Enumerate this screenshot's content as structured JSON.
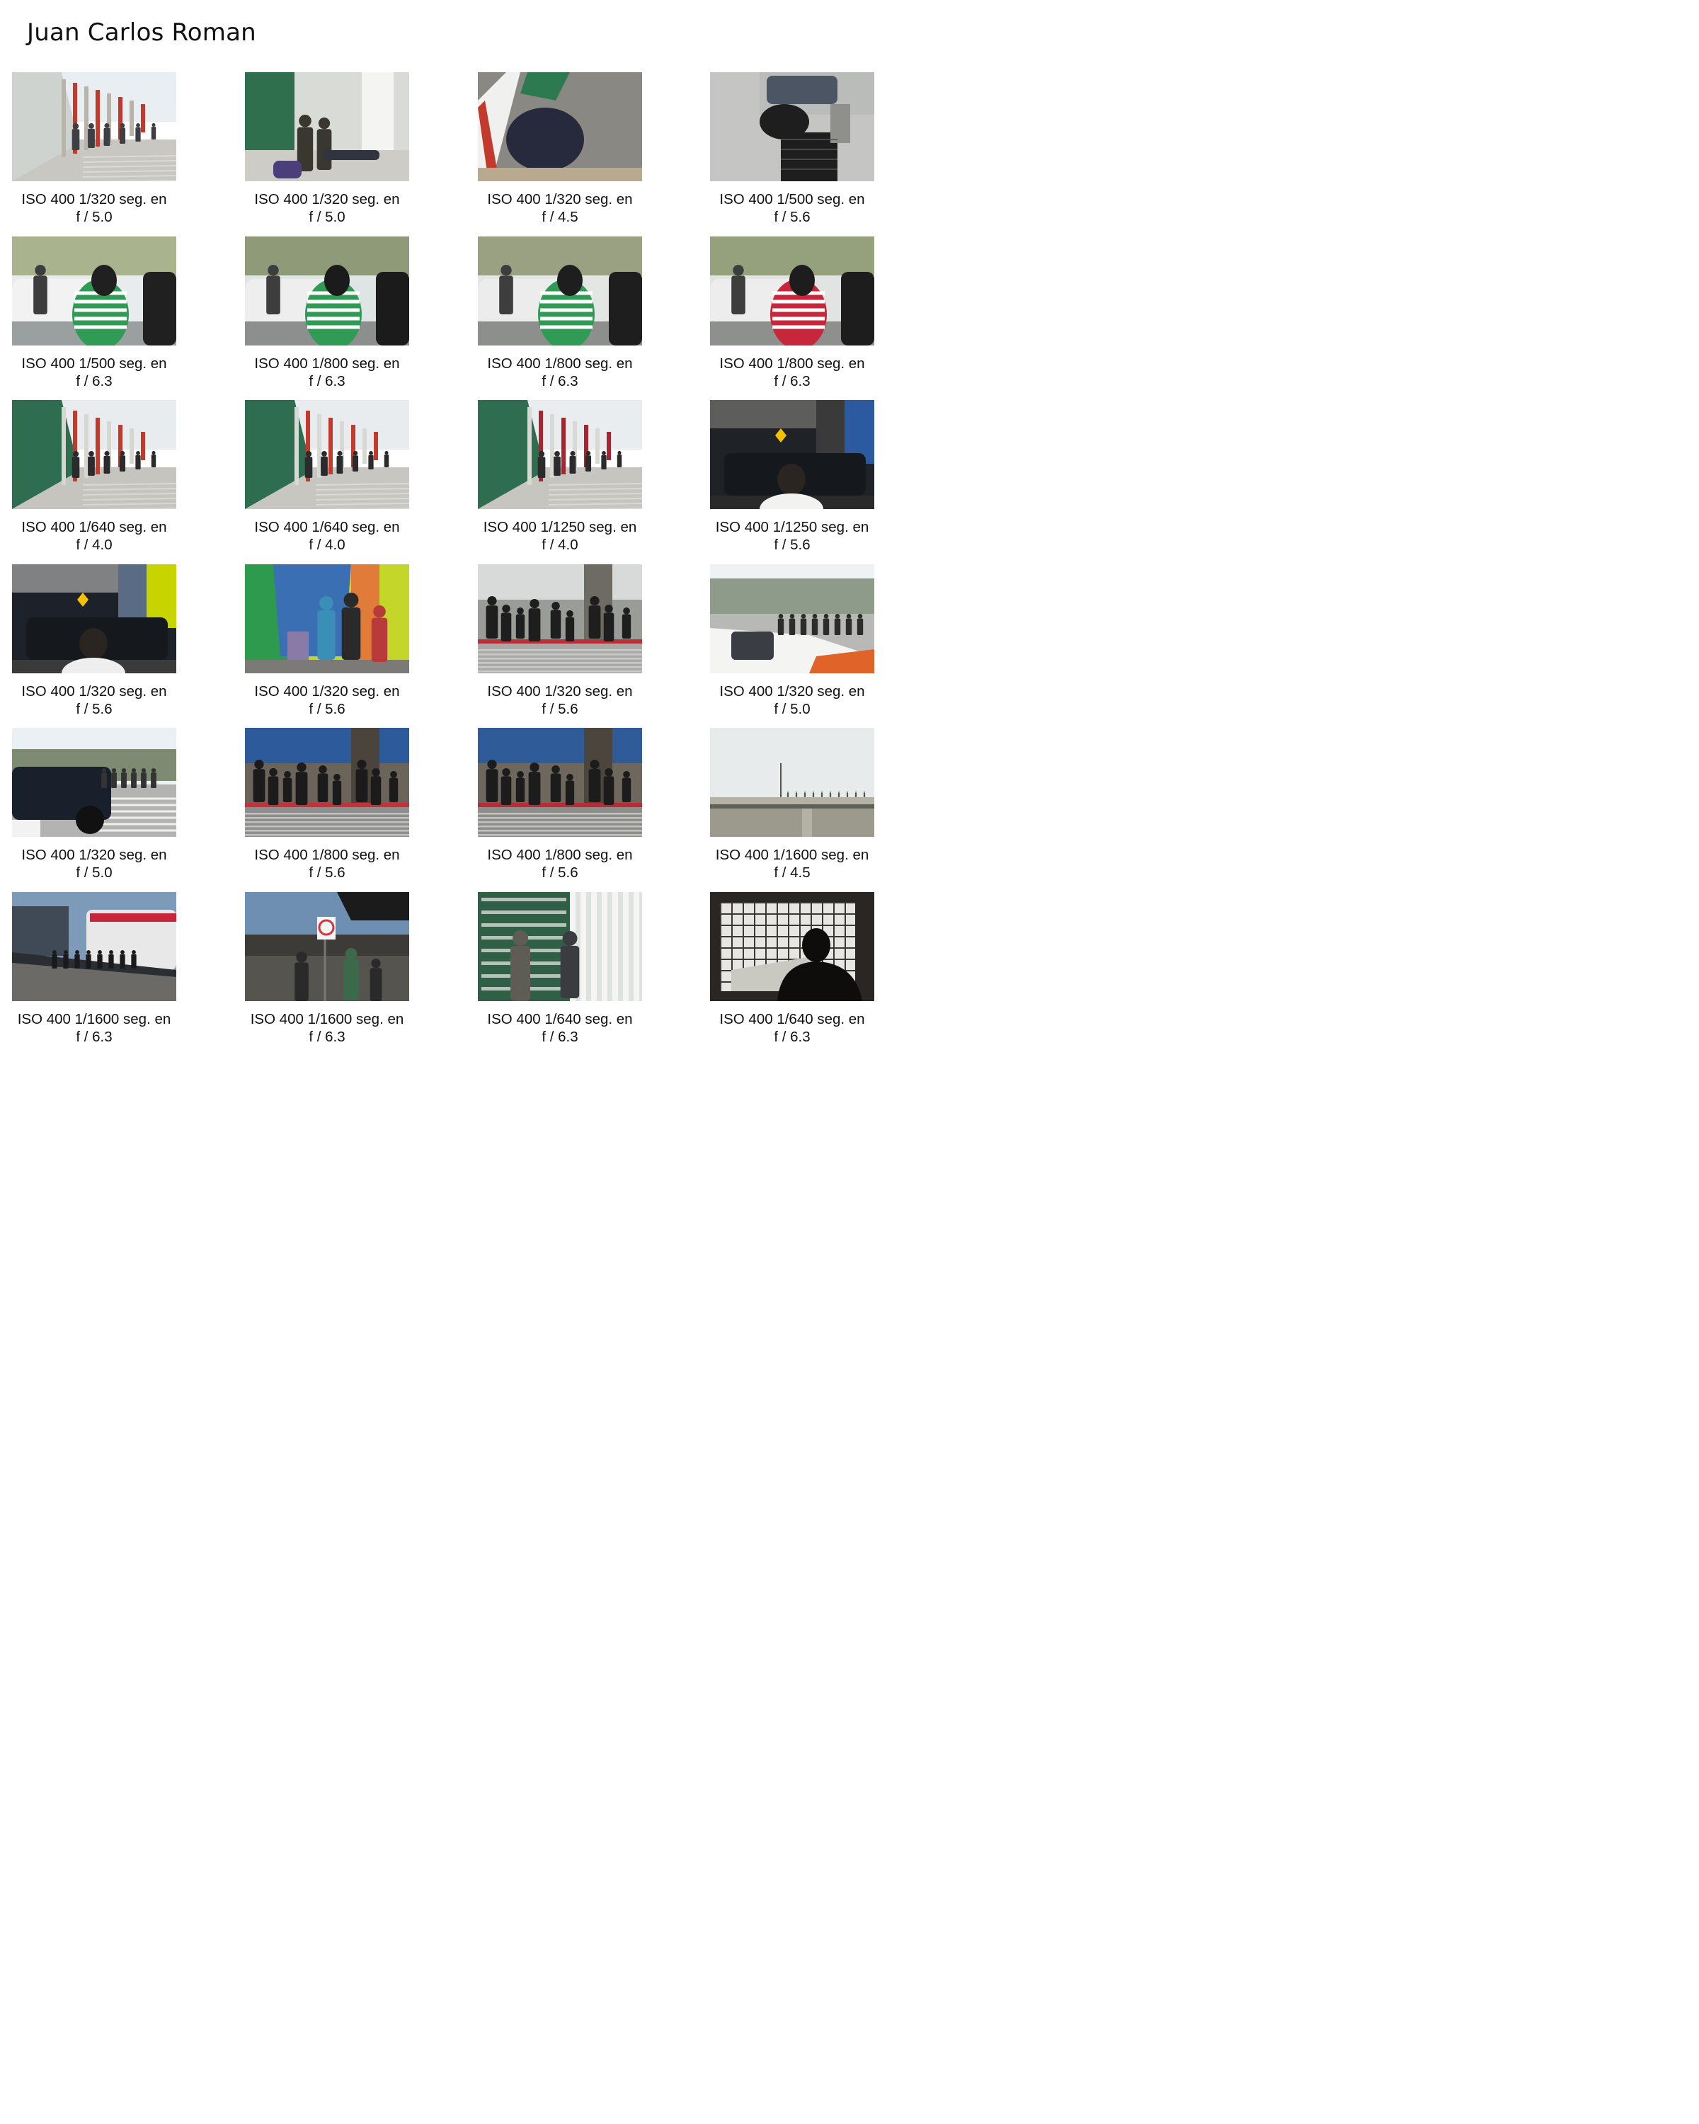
{
  "title": "Juan Carlos Roman",
  "photos": [
    {
      "exposure": "ISO 400 1/320 seg. en",
      "aperture": "f / 5.0",
      "scene": "letters-street",
      "colors": {
        "sky": "#e9eef2",
        "top": "#cfd3cf",
        "mid": "#b8b4aa",
        "ground": "#c9c7c2",
        "accent": "#c23a2c",
        "subject": "#3d3f44"
      }
    },
    {
      "exposure": "ISO 400 1/320 seg. en",
      "aperture": "f / 5.0",
      "scene": "letters-close",
      "colors": {
        "sky": "#eef1f0",
        "top": "#2f6f4e",
        "mid": "#d9dcd6",
        "ground": "#cdccc6",
        "accent": "#2b7a52",
        "subject": "#3a3630"
      }
    },
    {
      "exposure": "ISO 400 1/320 seg. en",
      "aperture": "f / 4.5",
      "scene": "ground-sitting",
      "colors": {
        "sky": "#8e8d88",
        "top": "#2e7a50",
        "mid": "#6f6c66",
        "ground": "#8a8883",
        "accent": "#c23a2c",
        "subject": "#262a3c"
      }
    },
    {
      "exposure": "ISO 400 1/500 seg. en",
      "aperture": "f / 5.6",
      "scene": "cart-street",
      "colors": {
        "sky": "#d9dbd8",
        "top": "#b9bcb9",
        "mid": "#8f8f8c",
        "ground": "#c5c6c4",
        "accent": "#4b5563",
        "subject": "#1e1e1f"
      }
    },
    {
      "exposure": "ISO 400 1/500 seg. en",
      "aperture": "f / 6.3",
      "scene": "crowd-taxi",
      "colors": {
        "sky": "#e8ecee",
        "top": "#a9b48f",
        "mid": "#f2f2f2",
        "ground": "#9aa0a0",
        "accent": "#2f9b55",
        "subject": "#202020"
      }
    },
    {
      "exposure": "ISO 400 1/800 seg. en",
      "aperture": "f / 6.3",
      "scene": "crowd-taxi",
      "colors": {
        "sky": "#dfe4e4",
        "top": "#8f9a79",
        "mid": "#eeeeee",
        "ground": "#8c8f8d",
        "accent": "#2f9b55",
        "subject": "#1b1b1b"
      }
    },
    {
      "exposure": "ISO 400 1/800 seg. en",
      "aperture": "f / 6.3",
      "scene": "crowd-taxi",
      "colors": {
        "sky": "#e4e6e4",
        "top": "#9aa183",
        "mid": "#ececec",
        "ground": "#8d8f8c",
        "accent": "#2f9b55",
        "subject": "#1e1e1e"
      }
    },
    {
      "exposure": "ISO 400 1/800 seg. en",
      "aperture": "f / 6.3",
      "scene": "crowd-taxi",
      "colors": {
        "sky": "#e1e4e2",
        "top": "#95a07d",
        "mid": "#ededed",
        "ground": "#8e908d",
        "accent": "#c8263a",
        "subject": "#1d1d1d"
      }
    },
    {
      "exposure": "ISO 400 1/640 seg. en",
      "aperture": "f / 4.0",
      "scene": "letters-street",
      "colors": {
        "sky": "#e8ecef",
        "top": "#2e6d4f",
        "mid": "#d7d7d2",
        "ground": "#c5c4be",
        "accent": "#c23a2c",
        "subject": "#2b2b2d"
      }
    },
    {
      "exposure": "ISO 400 1/640 seg. en",
      "aperture": "f / 4.0",
      "scene": "letters-street",
      "colors": {
        "sky": "#e9ecee",
        "top": "#2e6d4f",
        "mid": "#d9d9d4",
        "ground": "#c7c6c0",
        "accent": "#c23a2c",
        "subject": "#2b2b2d"
      }
    },
    {
      "exposure": "ISO 400 1/1250 seg. en",
      "aperture": "f / 4.0",
      "scene": "letters-street",
      "colors": {
        "sky": "#eaedef",
        "top": "#2e6d4f",
        "mid": "#d9d9d4",
        "ground": "#c6c5bf",
        "accent": "#a8242f",
        "subject": "#2b2b2d"
      }
    },
    {
      "exposure": "ISO 400 1/1250 seg. en",
      "aperture": "f / 5.6",
      "scene": "police-dark",
      "colors": {
        "sky": "#5d5d5c",
        "top": "#3a3a3b",
        "mid": "#1f2226",
        "ground": "#2a2a2a",
        "accent": "#2c5aa0",
        "subject": "#f2f2f0"
      }
    },
    {
      "exposure": "ISO 400 1/320 seg. en",
      "aperture": "f / 5.6",
      "scene": "police-dark",
      "colors": {
        "sky": "#7f8183",
        "top": "#5a6b84",
        "mid": "#1d222a",
        "ground": "#3a3a3a",
        "accent": "#c8d400",
        "subject": "#efefef"
      }
    },
    {
      "exposure": "ISO 400 1/320 seg. en",
      "aperture": "f / 5.6",
      "scene": "colorful-wall",
      "colors": {
        "sky": "#c4d62a",
        "top": "#3a6fb4",
        "mid": "#e07b3a",
        "ground": "#7c7a76",
        "accent": "#2d9a4e",
        "subject": "#2a2a2a"
      }
    },
    {
      "exposure": "ISO 400 1/320 seg. en",
      "aperture": "f / 5.6",
      "scene": "crossing",
      "colors": {
        "sky": "#d8dada",
        "top": "#9a9c97",
        "mid": "#6e6a64",
        "ground": "#a9aaa7",
        "accent": "#b8303a",
        "subject": "#1e1e1e"
      }
    },
    {
      "exposure": "ISO 400 1/320 seg. en",
      "aperture": "f / 5.0",
      "scene": "taxi-street",
      "colors": {
        "sky": "#eef2f4",
        "top": "#8e9a8a",
        "mid": "#d9dcd8",
        "ground": "#b8b9b6",
        "accent": "#e0632a",
        "subject": "#2c2c2c"
      }
    },
    {
      "exposure": "ISO 400 1/320 seg. en",
      "aperture": "f / 5.0",
      "scene": "jeep-street",
      "colors": {
        "sky": "#eaf0f4",
        "top": "#7d8b73",
        "mid": "#c9ccc8",
        "ground": "#b3b4b1",
        "accent": "#1f2a44",
        "subject": "#1a1f2c"
      }
    },
    {
      "exposure": "ISO 400 1/800 seg. en",
      "aperture": "f / 5.6",
      "scene": "crossing",
      "colors": {
        "sky": "#2d5a9a",
        "top": "#6a645b",
        "mid": "#4a443c",
        "ground": "#8e8f8c",
        "accent": "#c8303a",
        "subject": "#1b1b1b"
      }
    },
    {
      "exposure": "ISO 400 1/800 seg. en",
      "aperture": "f / 5.6",
      "scene": "crossing",
      "colors": {
        "sky": "#2f5b98",
        "top": "#6e675d",
        "mid": "#4b453d",
        "ground": "#8d8e8b",
        "accent": "#b92c36",
        "subject": "#1c1c1c"
      }
    },
    {
      "exposure": "ISO 400 1/1600 seg. en",
      "aperture": "f / 4.5",
      "scene": "bridge",
      "colors": {
        "sky": "#e7ebec",
        "top": "#d4d8d6",
        "mid": "#b3b2a5",
        "ground": "#9c9a8d",
        "accent": "#5e6157",
        "subject": "#54564f"
      }
    },
    {
      "exposure": "ISO 400 1/1600 seg. en",
      "aperture": "f / 6.3",
      "scene": "bus-line",
      "colors": {
        "sky": "#7d9ab8",
        "top": "#3f4a56",
        "mid": "#2a2e33",
        "ground": "#6c6a66",
        "accent": "#c8263a",
        "subject": "#1a1a1a"
      }
    },
    {
      "exposure": "ISO 400 1/1600 seg. en",
      "aperture": "f / 6.3",
      "scene": "street-sign",
      "colors": {
        "sky": "#6e8fb2",
        "top": "#1b1b1c",
        "mid": "#3c3b38",
        "ground": "#56544f",
        "accent": "#d6333a",
        "subject": "#2a2a2a"
      }
    },
    {
      "exposure": "ISO 400 1/640 seg. en",
      "aperture": "f / 6.3",
      "scene": "letters-bars",
      "colors": {
        "sky": "#e4e7e3",
        "top": "#2f5f45",
        "mid": "#dfe3df",
        "ground": "#bdbdb8",
        "accent": "#2e6a4c",
        "subject": "#3b3c40"
      }
    },
    {
      "exposure": "ISO 400 1/640 seg. en",
      "aperture": "f / 6.3",
      "scene": "window-silhouette",
      "colors": {
        "sky": "#e6e6e2",
        "top": "#2a2623",
        "mid": "#c9c8c1",
        "ground": "#3c3733",
        "accent": "#8a8680",
        "subject": "#0f0d0c"
      }
    }
  ]
}
